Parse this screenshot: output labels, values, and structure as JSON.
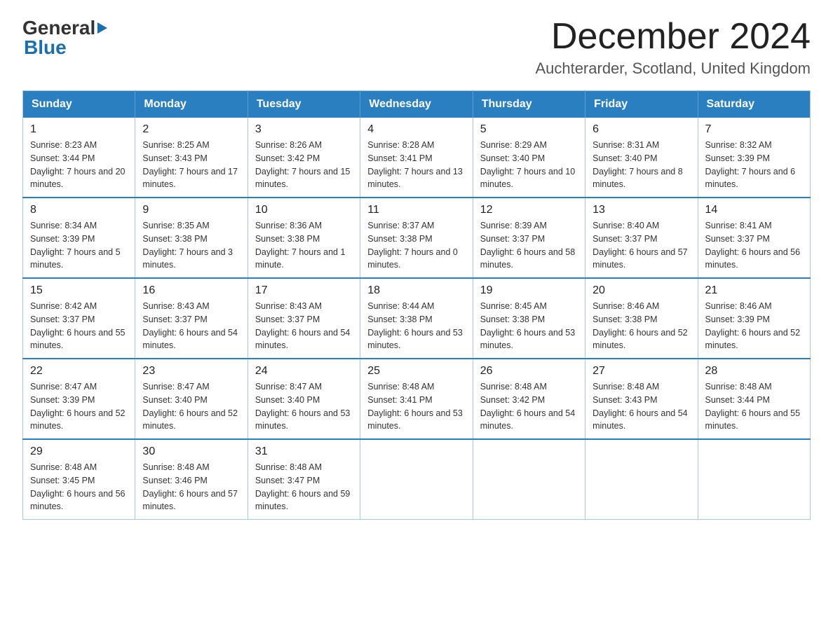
{
  "logo": {
    "part1": "General",
    "part2": "Blue"
  },
  "header": {
    "month_year": "December 2024",
    "location": "Auchterarder, Scotland, United Kingdom"
  },
  "weekdays": [
    "Sunday",
    "Monday",
    "Tuesday",
    "Wednesday",
    "Thursday",
    "Friday",
    "Saturday"
  ],
  "weeks": [
    [
      {
        "day": "1",
        "sunrise": "8:23 AM",
        "sunset": "3:44 PM",
        "daylight": "7 hours and 20 minutes."
      },
      {
        "day": "2",
        "sunrise": "8:25 AM",
        "sunset": "3:43 PM",
        "daylight": "7 hours and 17 minutes."
      },
      {
        "day": "3",
        "sunrise": "8:26 AM",
        "sunset": "3:42 PM",
        "daylight": "7 hours and 15 minutes."
      },
      {
        "day": "4",
        "sunrise": "8:28 AM",
        "sunset": "3:41 PM",
        "daylight": "7 hours and 13 minutes."
      },
      {
        "day": "5",
        "sunrise": "8:29 AM",
        "sunset": "3:40 PM",
        "daylight": "7 hours and 10 minutes."
      },
      {
        "day": "6",
        "sunrise": "8:31 AM",
        "sunset": "3:40 PM",
        "daylight": "7 hours and 8 minutes."
      },
      {
        "day": "7",
        "sunrise": "8:32 AM",
        "sunset": "3:39 PM",
        "daylight": "7 hours and 6 minutes."
      }
    ],
    [
      {
        "day": "8",
        "sunrise": "8:34 AM",
        "sunset": "3:39 PM",
        "daylight": "7 hours and 5 minutes."
      },
      {
        "day": "9",
        "sunrise": "8:35 AM",
        "sunset": "3:38 PM",
        "daylight": "7 hours and 3 minutes."
      },
      {
        "day": "10",
        "sunrise": "8:36 AM",
        "sunset": "3:38 PM",
        "daylight": "7 hours and 1 minute."
      },
      {
        "day": "11",
        "sunrise": "8:37 AM",
        "sunset": "3:38 PM",
        "daylight": "7 hours and 0 minutes."
      },
      {
        "day": "12",
        "sunrise": "8:39 AM",
        "sunset": "3:37 PM",
        "daylight": "6 hours and 58 minutes."
      },
      {
        "day": "13",
        "sunrise": "8:40 AM",
        "sunset": "3:37 PM",
        "daylight": "6 hours and 57 minutes."
      },
      {
        "day": "14",
        "sunrise": "8:41 AM",
        "sunset": "3:37 PM",
        "daylight": "6 hours and 56 minutes."
      }
    ],
    [
      {
        "day": "15",
        "sunrise": "8:42 AM",
        "sunset": "3:37 PM",
        "daylight": "6 hours and 55 minutes."
      },
      {
        "day": "16",
        "sunrise": "8:43 AM",
        "sunset": "3:37 PM",
        "daylight": "6 hours and 54 minutes."
      },
      {
        "day": "17",
        "sunrise": "8:43 AM",
        "sunset": "3:37 PM",
        "daylight": "6 hours and 54 minutes."
      },
      {
        "day": "18",
        "sunrise": "8:44 AM",
        "sunset": "3:38 PM",
        "daylight": "6 hours and 53 minutes."
      },
      {
        "day": "19",
        "sunrise": "8:45 AM",
        "sunset": "3:38 PM",
        "daylight": "6 hours and 53 minutes."
      },
      {
        "day": "20",
        "sunrise": "8:46 AM",
        "sunset": "3:38 PM",
        "daylight": "6 hours and 52 minutes."
      },
      {
        "day": "21",
        "sunrise": "8:46 AM",
        "sunset": "3:39 PM",
        "daylight": "6 hours and 52 minutes."
      }
    ],
    [
      {
        "day": "22",
        "sunrise": "8:47 AM",
        "sunset": "3:39 PM",
        "daylight": "6 hours and 52 minutes."
      },
      {
        "day": "23",
        "sunrise": "8:47 AM",
        "sunset": "3:40 PM",
        "daylight": "6 hours and 52 minutes."
      },
      {
        "day": "24",
        "sunrise": "8:47 AM",
        "sunset": "3:40 PM",
        "daylight": "6 hours and 53 minutes."
      },
      {
        "day": "25",
        "sunrise": "8:48 AM",
        "sunset": "3:41 PM",
        "daylight": "6 hours and 53 minutes."
      },
      {
        "day": "26",
        "sunrise": "8:48 AM",
        "sunset": "3:42 PM",
        "daylight": "6 hours and 54 minutes."
      },
      {
        "day": "27",
        "sunrise": "8:48 AM",
        "sunset": "3:43 PM",
        "daylight": "6 hours and 54 minutes."
      },
      {
        "day": "28",
        "sunrise": "8:48 AM",
        "sunset": "3:44 PM",
        "daylight": "6 hours and 55 minutes."
      }
    ],
    [
      {
        "day": "29",
        "sunrise": "8:48 AM",
        "sunset": "3:45 PM",
        "daylight": "6 hours and 56 minutes."
      },
      {
        "day": "30",
        "sunrise": "8:48 AM",
        "sunset": "3:46 PM",
        "daylight": "6 hours and 57 minutes."
      },
      {
        "day": "31",
        "sunrise": "8:48 AM",
        "sunset": "3:47 PM",
        "daylight": "6 hours and 59 minutes."
      },
      null,
      null,
      null,
      null
    ]
  ]
}
